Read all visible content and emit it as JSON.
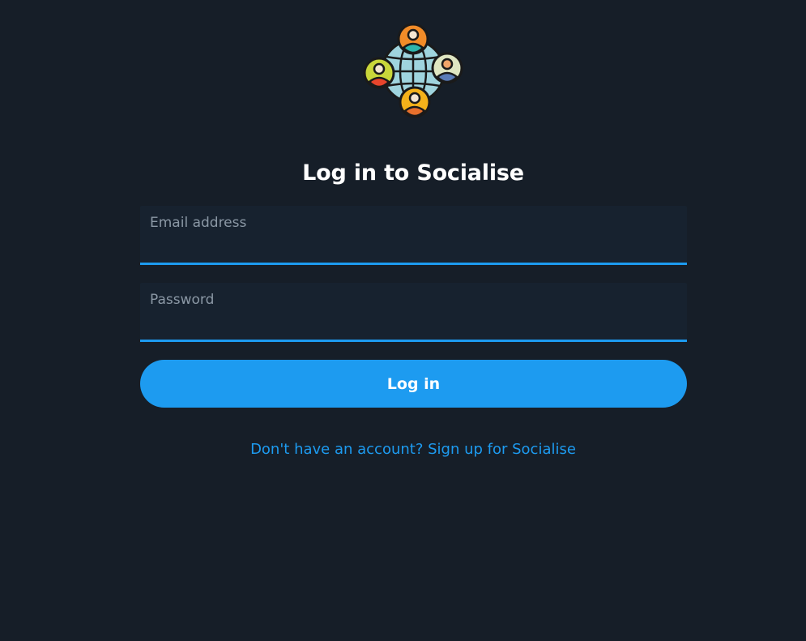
{
  "brand": {
    "logo_icon": "globe-people-icon",
    "colors": {
      "background": "#161e28",
      "field_background": "#17222f",
      "accent": "#1d9bf0"
    }
  },
  "login": {
    "title": "Log in to Socialise",
    "email": {
      "label": "Email address",
      "value": ""
    },
    "password": {
      "label": "Password",
      "value": ""
    },
    "submit_label": "Log in",
    "signup_link": "Don't have an account? Sign up for Socialise"
  }
}
